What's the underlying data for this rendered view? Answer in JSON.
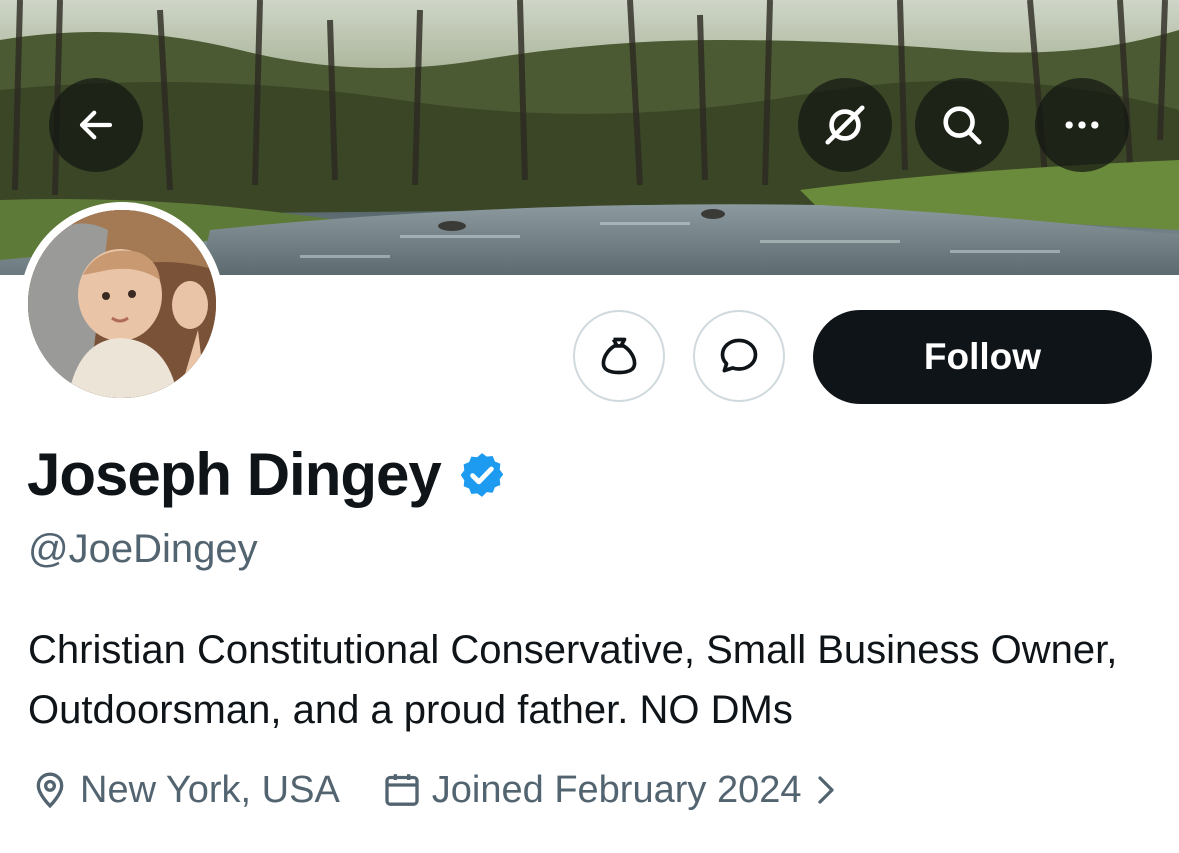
{
  "header": {
    "back_icon": "arrow-left-icon",
    "grok_icon": "grok-icon",
    "search_icon": "search-icon",
    "more_icon": "more-horizontal-icon"
  },
  "profile": {
    "display_name": "Joseph Dingey",
    "verified": true,
    "verified_color": "#1d9bf0",
    "handle": "@JoeDingey",
    "bio": "Christian Constitutional Conservative, Small Business Owner, Outdoorsman, and a proud father. NO DMs",
    "location": "New York, USA",
    "joined": "Joined February 2024"
  },
  "actions": {
    "tip_icon": "money-bag-icon",
    "message_icon": "message-bubble-icon",
    "follow_label": "Follow"
  },
  "colors": {
    "primary_text": "#0f1419",
    "secondary_text": "#536471",
    "follow_bg": "#0f1419",
    "outline_border": "#cfd9de"
  }
}
